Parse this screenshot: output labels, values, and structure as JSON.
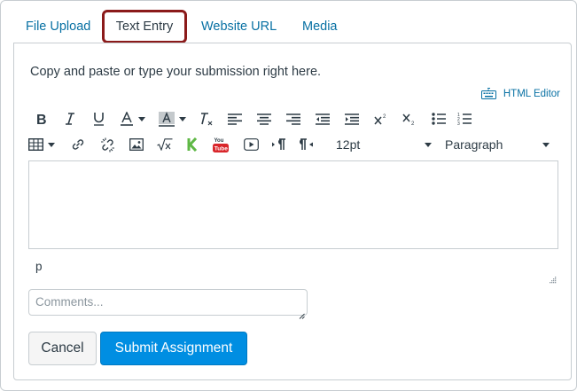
{
  "tabs": [
    {
      "label": "File Upload",
      "active": false
    },
    {
      "label": "Text Entry",
      "active": true
    },
    {
      "label": "Website URL",
      "active": false
    },
    {
      "label": "Media",
      "active": false
    }
  ],
  "instructions": "Copy and paste or type your submission right here.",
  "html_editor_label": "HTML Editor",
  "toolbar": {
    "font_size": "12pt",
    "block_format": "Paragraph",
    "row1_icons": [
      "bold-icon",
      "italic-icon",
      "underline-icon",
      "text-color-icon",
      "background-color-icon",
      "clear-formatting-icon",
      "align-left-icon",
      "align-center-icon",
      "align-right-icon",
      "outdent-icon",
      "indent-icon",
      "superscript-icon",
      "subscript-icon",
      "bullet-list-icon",
      "numbered-list-icon"
    ],
    "row2_icons": [
      "table-icon",
      "link-icon",
      "unlink-icon",
      "image-icon",
      "math-equation-icon",
      "kaltura-icon",
      "youtube-icon",
      "media-icon",
      "ltr-icon",
      "rtl-icon"
    ]
  },
  "editor": {
    "content": "",
    "path": "p"
  },
  "comments": {
    "placeholder": "Comments...",
    "value": ""
  },
  "buttons": {
    "cancel": "Cancel",
    "submit": "Submit Assignment"
  },
  "colors": {
    "link": "#0770a3",
    "primary": "#008ee2",
    "active_tab_border": "#8b1a1a",
    "text": "#2d3b45"
  }
}
